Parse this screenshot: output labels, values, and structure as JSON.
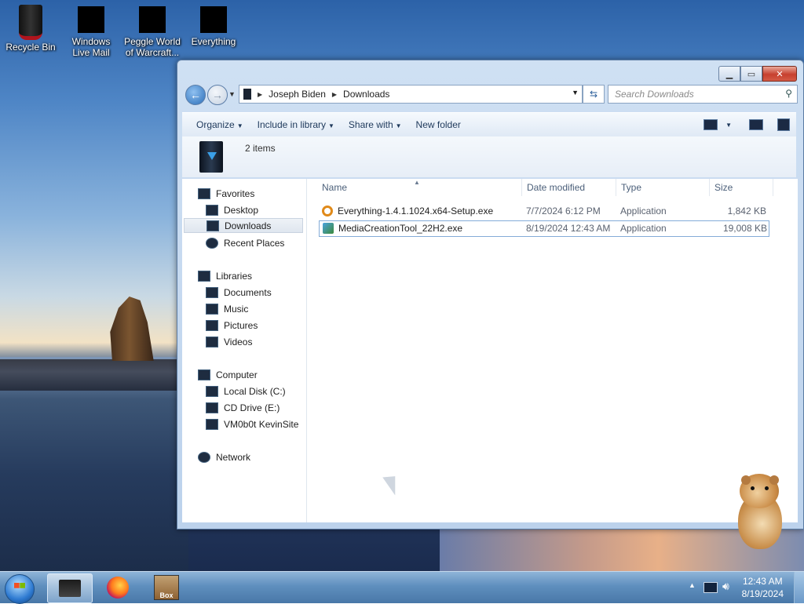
{
  "desktop": {
    "icons": [
      {
        "label": "Recycle Bin"
      },
      {
        "label": "Windows Live Mail"
      },
      {
        "label": "Peggle World of Warcraft..."
      },
      {
        "label": "Everything"
      }
    ]
  },
  "window": {
    "address": {
      "crumbs": [
        "Joseph Biden",
        "Downloads"
      ]
    },
    "search_placeholder": "Search Downloads",
    "toolbar": {
      "organize": "Organize",
      "include_in_library": "Include in library",
      "share_with": "Share with",
      "new_folder": "New folder"
    },
    "details": {
      "item_count": "2 items"
    },
    "nav": {
      "favorites": "Favorites",
      "desktop": "Desktop",
      "downloads": "Downloads",
      "recent_places": "Recent Places",
      "libraries": "Libraries",
      "documents": "Documents",
      "music": "Music",
      "pictures": "Pictures",
      "videos": "Videos",
      "computer": "Computer",
      "local_disk": "Local Disk (C:)",
      "cd_drive": "CD Drive (E:)",
      "vm_site": "VM0b0t KevinSite",
      "network": "Network"
    },
    "columns": {
      "name": "Name",
      "date_modified": "Date modified",
      "type": "Type",
      "size": "Size"
    },
    "files": [
      {
        "name": "Everything-1.4.1.1024.x64-Setup.exe",
        "date": "7/7/2024 6:12 PM",
        "type": "Application",
        "size": "1,842 KB"
      },
      {
        "name": "MediaCreationTool_22H2.exe",
        "date": "8/19/2024 12:43 AM",
        "type": "Application",
        "size": "19,008 KB"
      }
    ]
  },
  "taskbar": {
    "pinned": [
      "explorer",
      "firefox",
      "box"
    ],
    "box_label": "Box",
    "clock": {
      "time": "12:43 AM",
      "date": "8/19/2024"
    }
  }
}
